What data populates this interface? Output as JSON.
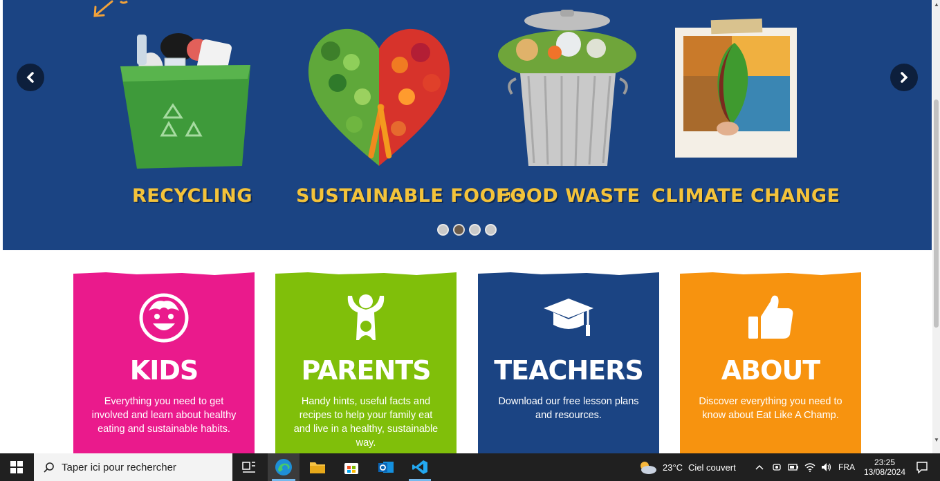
{
  "carousel": {
    "slides": [
      {
        "label": "RECYCLING",
        "icon": "recycling-bin-image"
      },
      {
        "label": "SUSTAINABLE FOODS",
        "icon": "vegetable-heart-image"
      },
      {
        "label": "FOOD WASTE",
        "icon": "food-waste-bin-image"
      },
      {
        "label": "CLIMATE CHANGE",
        "icon": "climate-polaroid-image"
      }
    ],
    "active_dot": 1,
    "dot_count": 4
  },
  "cards": [
    {
      "title": "KIDS",
      "desc": "Everything you need to get involved and learn about healthy eating and sustainable habits.",
      "color": "#ea1a8c",
      "icon": "smiley-face-icon"
    },
    {
      "title": "PARENTS",
      "desc": "Handy hints, useful facts and recipes to help your family eat and live in a healthy, sustainable way.",
      "color": "#80bf0a",
      "icon": "parent-child-icon"
    },
    {
      "title": "TEACHERS",
      "desc": "Download our free lesson plans and resources.",
      "color": "#1b4483",
      "icon": "graduation-cap-icon"
    },
    {
      "title": "ABOUT",
      "desc": "Discover everything you need to know about Eat Like A Champ.",
      "color": "#f7930f",
      "icon": "thumbs-up-icon"
    }
  ],
  "taskbar": {
    "search_placeholder": "Taper ici pour rechercher",
    "weather_temp": "23°C",
    "weather_desc": "Ciel couvert",
    "language": "FRA",
    "time": "23:25",
    "date": "13/08/2024"
  }
}
